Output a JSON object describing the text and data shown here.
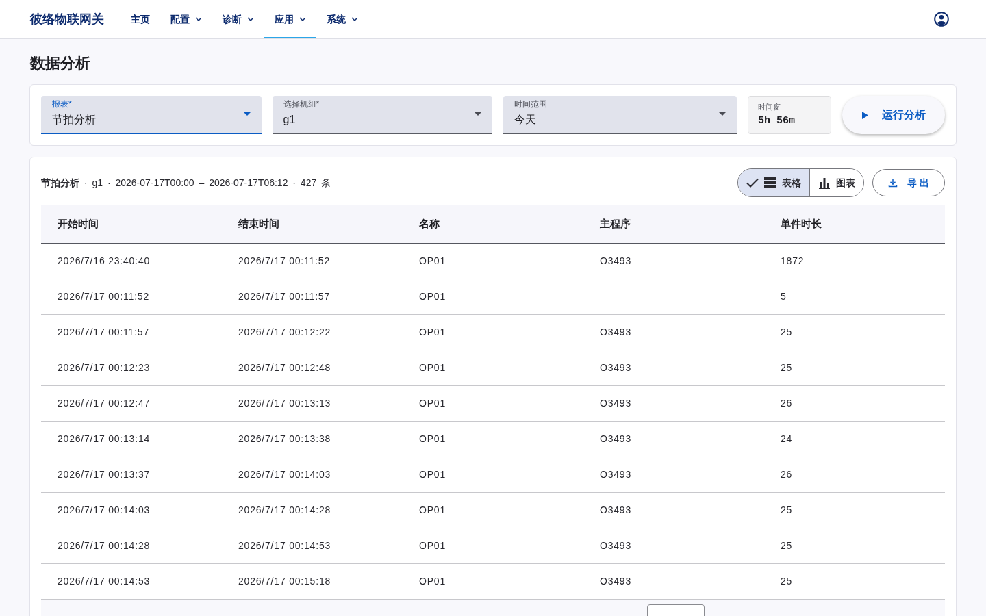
{
  "navbar": {
    "brand": "彼络物联网关",
    "items": [
      {
        "label": "主页",
        "dropdown": false,
        "selected": false
      },
      {
        "label": "配置",
        "dropdown": true,
        "selected": false
      },
      {
        "label": "诊断",
        "dropdown": true,
        "selected": false
      },
      {
        "label": "应用",
        "dropdown": true,
        "selected": true
      },
      {
        "label": "系统",
        "dropdown": true,
        "selected": false
      }
    ]
  },
  "page_title": "数据分析",
  "filters": [
    {
      "label": "报表*",
      "value": "节拍分析",
      "focused": true
    },
    {
      "label": "选择机组*",
      "value": "g1",
      "focused": false
    },
    {
      "label": "时间范围",
      "value": "今天",
      "focused": false
    }
  ],
  "time_window": {
    "label": "时间窗",
    "value": "5h 56m"
  },
  "run_button": "运行分析",
  "summary": "**节拍分析** · g1 · 2026-07-17T00:00 – 2026-07-17T06:12 · 427 条",
  "view_toggle": [
    {
      "kind": "table",
      "label": "表格",
      "selected": true
    },
    {
      "kind": "chart",
      "label": "图表",
      "selected": false
    }
  ],
  "export_button": "导 出",
  "table": {
    "columns": [
      "开始时间",
      "结束时间",
      "名称",
      "主程序",
      "单件时长"
    ],
    "rows": [
      [
        "2026/7/16 23:40:40",
        "2026/7/17 00:11:52",
        "OP01",
        "O3493",
        "1872"
      ],
      [
        "2026/7/17 00:11:52",
        "2026/7/17 00:11:57",
        "OP01",
        null,
        "5"
      ],
      [
        "2026/7/17 00:11:57",
        "2026/7/17 00:12:22",
        "OP01",
        "O3493",
        "25"
      ],
      [
        "2026/7/17 00:12:23",
        "2026/7/17 00:12:48",
        "OP01",
        "O3493",
        "25"
      ],
      [
        "2026/7/17 00:12:47",
        "2026/7/17 00:13:13",
        "OP01",
        "O3493",
        "26"
      ],
      [
        "2026/7/17 00:13:14",
        "2026/7/17 00:13:38",
        "OP01",
        "O3493",
        "24"
      ],
      [
        "2026/7/17 00:13:37",
        "2026/7/17 00:14:03",
        "OP01",
        "O3493",
        "26"
      ],
      [
        "2026/7/17 00:14:03",
        "2026/7/17 00:14:28",
        "OP01",
        "O3493",
        "25"
      ],
      [
        "2026/7/17 00:14:28",
        "2026/7/17 00:14:53",
        "OP01",
        "O3493",
        "25"
      ],
      [
        "2026/7/17 00:14:53",
        "2026/7/17 00:15:18",
        "OP01",
        "O3493",
        "25"
      ]
    ]
  }
}
